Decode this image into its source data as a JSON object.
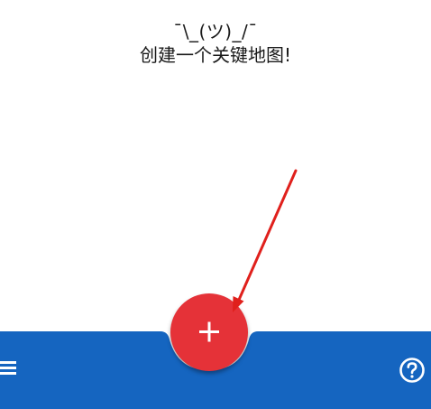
{
  "empty_state": {
    "emoticon": "¯\\_(ツ)_/¯",
    "message": "创建一个关键地图!"
  },
  "icons": {
    "menu": "hamburger-menu-icon",
    "help": "help-circle-icon",
    "fab": "plus-icon"
  },
  "colors": {
    "bar": "#1565c0",
    "fab": "#e53238",
    "arrow": "#e0201c",
    "icon": "#ffffff"
  }
}
